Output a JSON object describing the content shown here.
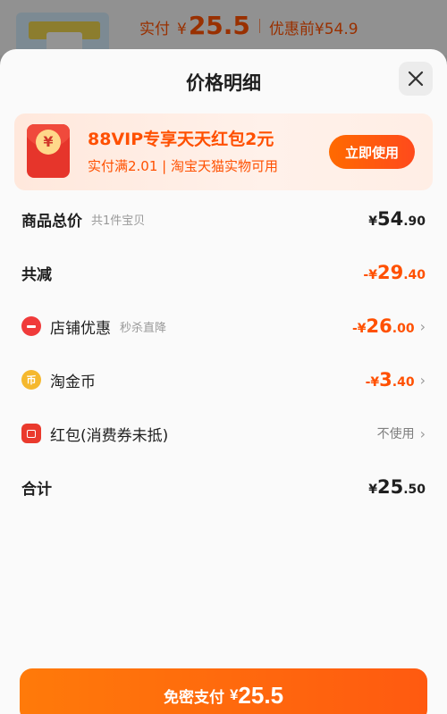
{
  "top_bar": {
    "actual_label": "实付",
    "currency": "¥",
    "actual_price": "25.5",
    "before_label": "优惠前",
    "before_price": "¥54.9"
  },
  "sheet": {
    "title": "价格明细"
  },
  "vip_banner": {
    "title": "88VIP专享天天红包2元",
    "subtitle": "实付满2.01 | 淘宝天猫实物可用",
    "button_label": "立即使用",
    "coin_symbol": "¥"
  },
  "rows": {
    "total": {
      "label": "商品总价",
      "note": "共1件宝贝",
      "yen": "¥",
      "int": "54",
      "dec": ".90"
    },
    "reduce": {
      "label": "共减",
      "yen": "-¥",
      "int": "29",
      "dec": ".40"
    },
    "shop": {
      "label": "店铺优惠",
      "note": "秒杀直降",
      "yen": "-¥",
      "int": "26",
      "dec": ".00"
    },
    "coin": {
      "label": "淘金币",
      "yen": "-¥",
      "int": "3",
      "dec": ".40",
      "icon_text": "币"
    },
    "redpacket": {
      "label": "红包(消费券未抵)",
      "value": "不使用"
    },
    "sum": {
      "label": "合计",
      "yen": "¥",
      "int": "25",
      "dec": ".50"
    }
  },
  "pay_button": {
    "label": "免密支付",
    "currency": "¥",
    "amount": "25.5"
  },
  "colors": {
    "accent": "#ff5000",
    "button": "#ff6a00"
  }
}
